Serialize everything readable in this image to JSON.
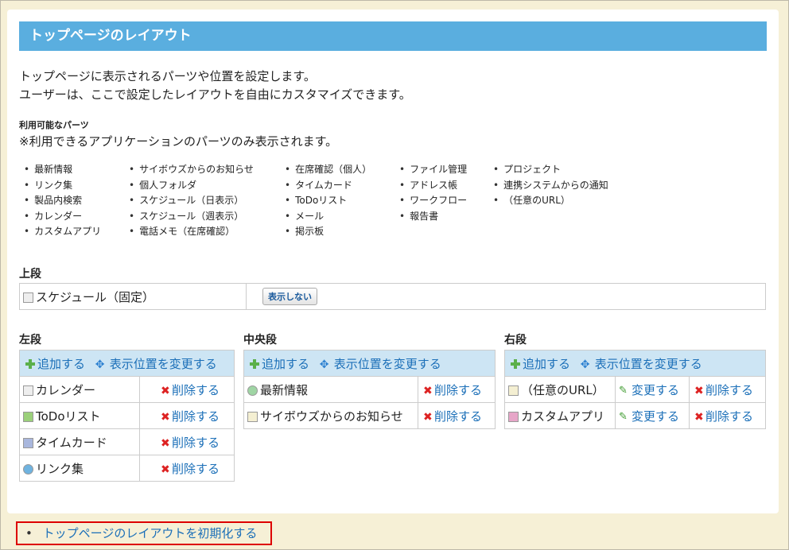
{
  "page": {
    "title": "トップページのレイアウト",
    "description_line1": "トップページに表示されるパーツや位置を設定します。",
    "description_line2": "ユーザーは、ここで設定したレイアウトを自由にカスタマイズできます。"
  },
  "parts": {
    "heading": "利用可能なパーツ",
    "note": "※利用できるアプリケーションのパーツのみ表示されます。",
    "columns": [
      [
        "最新情報",
        "リンク集",
        "製品内検索",
        "カレンダー",
        "カスタムアプリ"
      ],
      [
        "サイボウズからのお知らせ",
        "個人フォルダ",
        "スケジュール（日表示）",
        "スケジュール（週表示）",
        "電話メモ（在席確認）"
      ],
      [
        "在席確認（個人）",
        "タイムカード",
        "ToDoリスト",
        "メール",
        "掲示板"
      ],
      [
        "ファイル管理",
        "アドレス帳",
        "ワークフロー",
        "報告書"
      ],
      [
        "プロジェクト",
        "連携システムからの通知",
        "（任意のURL）"
      ]
    ]
  },
  "top": {
    "label": "上段",
    "item": "スケジュール（固定）",
    "hide_button": "表示しない"
  },
  "left": {
    "label": "左段",
    "add": "追加する",
    "move": "表示位置を変更する",
    "delete": "削除する",
    "items": [
      "カレンダー",
      "ToDoリスト",
      "タイムカード",
      "リンク集"
    ]
  },
  "center": {
    "label": "中央段",
    "add": "追加する",
    "move": "表示位置を変更する",
    "delete": "削除する",
    "items": [
      "最新情報",
      "サイボウズからのお知らせ"
    ]
  },
  "right": {
    "label": "右段",
    "add": "追加する",
    "move": "表示位置を変更する",
    "change": "変更する",
    "delete": "削除する",
    "items": [
      "（任意のURL）",
      "カスタムアプリ"
    ]
  },
  "reset_link": "トップページのレイアウトを初期化する"
}
